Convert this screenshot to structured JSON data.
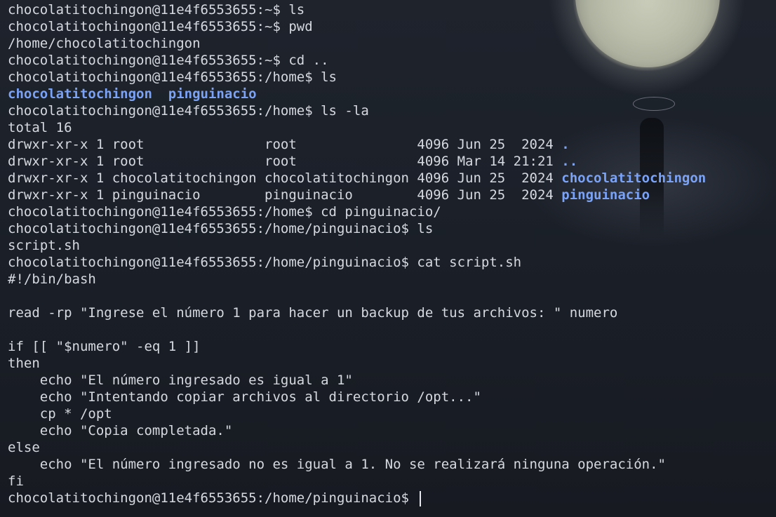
{
  "terminal": {
    "lines": [
      "chocolatitochingon@11e4f6553655:~$ ls",
      "chocolatitochingon@11e4f6553655:~$ pwd",
      "/home/chocolatitochingon",
      "chocolatitochingon@11e4f6553655:~$ cd ..",
      "chocolatitochingon@11e4f6553655:/home$ ls"
    ],
    "ls_home_dirs": [
      "chocolatitochingon",
      "pinguinacio"
    ],
    "ls_la_cmd": "chocolatitochingon@11e4f6553655:/home$ ls -la",
    "total": "total 16",
    "ls_la_rows": [
      {
        "prefix": "drwxr-xr-x 1 root               root               4096 Jun 25  2024 ",
        "name": "."
      },
      {
        "prefix": "drwxr-xr-x 1 root               root               4096 Mar 14 21:21 ",
        "name": ".."
      },
      {
        "prefix": "drwxr-xr-x 1 chocolatitochingon chocolatitochingon 4096 Jun 25  2024 ",
        "name": "chocolatitochingon"
      },
      {
        "prefix": "drwxr-xr-x 1 pinguinacio        pinguinacio        4096 Jun 25  2024 ",
        "name": "pinguinacio"
      }
    ],
    "after_lines": [
      "chocolatitochingon@11e4f6553655:/home$ cd pinguinacio/",
      "chocolatitochingon@11e4f6553655:/home/pinguinacio$ ls",
      "script.sh",
      "chocolatitochingon@11e4f6553655:/home/pinguinacio$ cat script.sh",
      "#!/bin/bash",
      "",
      "read -rp \"Ingrese el número 1 para hacer un backup de tus archivos: \" numero",
      "",
      "if [[ \"$numero\" -eq 1 ]]",
      "then",
      "    echo \"El número ingresado es igual a 1\"",
      "    echo \"Intentando copiar archivos al directorio /opt...\"",
      "    cp * /opt",
      "    echo \"Copia completada.\"",
      "else",
      "    echo \"El número ingresado no es igual a 1. No se realizará ninguna operación.\"",
      "fi"
    ],
    "prompt": "chocolatitochingon@11e4f6553655:/home/pinguinacio$ "
  },
  "colors": {
    "text": "#d6d9e0",
    "directory": "#7aa2f7",
    "background": "#1b2029"
  }
}
